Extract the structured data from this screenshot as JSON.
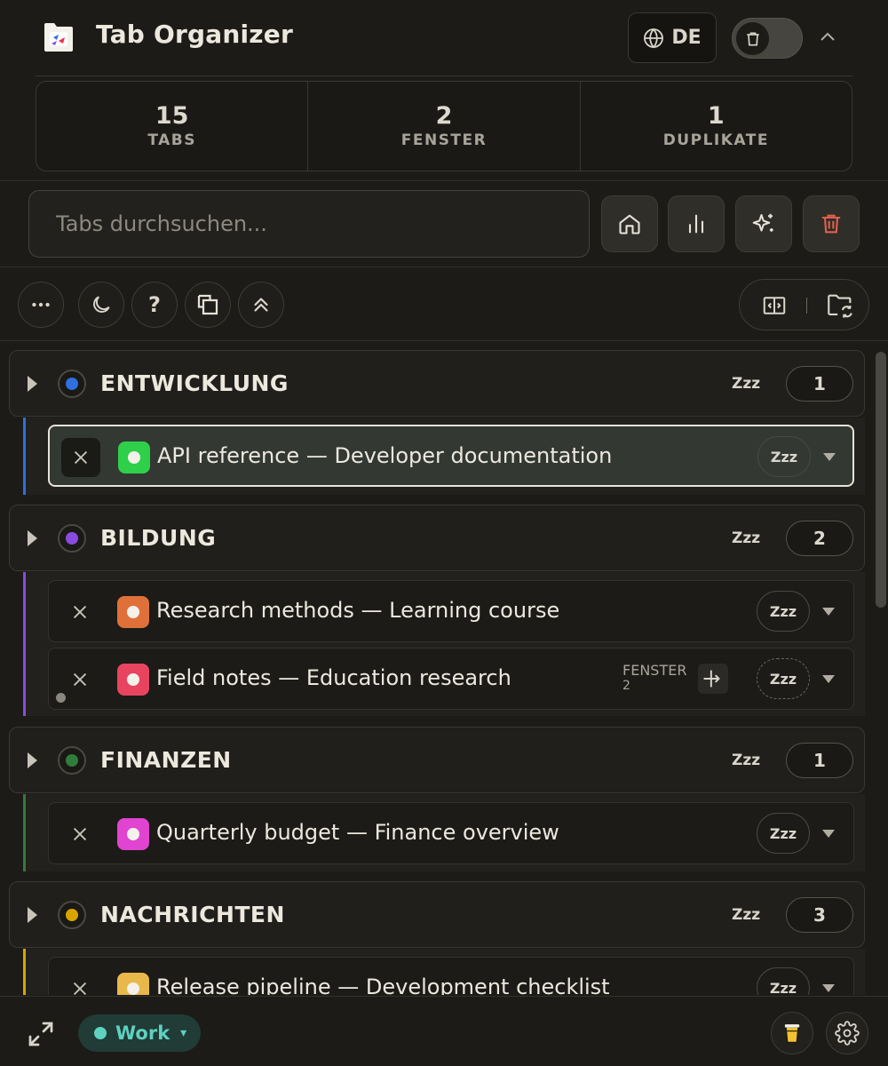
{
  "header": {
    "title": "Tab Organizer",
    "language": "DE"
  },
  "stats": [
    {
      "value": "15",
      "label": "TABS"
    },
    {
      "value": "2",
      "label": "FENSTER"
    },
    {
      "value": "1",
      "label": "DUPLIKATE"
    }
  ],
  "search": {
    "placeholder": "Tabs durchsuchen..."
  },
  "toolbar": {
    "help_label": "?"
  },
  "groups": [
    {
      "name": "ENTWICKLUNG",
      "count": "1",
      "zzz": "Zzz",
      "color": "#2f6fe0",
      "tabs": [
        {
          "title": "API reference — Developer documentation",
          "favicon_color": "#2ed04a",
          "zzz": "Zzz",
          "active": true
        }
      ]
    },
    {
      "name": "BILDUNG",
      "count": "2",
      "zzz": "Zzz",
      "color": "#8a4be0",
      "tabs": [
        {
          "title": "Research methods — Learning course",
          "favicon_color": "#e0703a",
          "zzz": "Zzz"
        },
        {
          "title": "Field notes — Education research",
          "favicon_color": "#e84460",
          "zzz": "Zzz",
          "window_label": "FENSTER",
          "window_number": "2"
        }
      ]
    },
    {
      "name": "FINANZEN",
      "count": "1",
      "zzz": "Zzz",
      "color": "#2e7d3a",
      "tabs": [
        {
          "title": "Quarterly budget — Finance overview",
          "favicon_color": "#e044d0",
          "zzz": "Zzz"
        }
      ]
    },
    {
      "name": "NACHRICHTEN",
      "count": "3",
      "zzz": "Zzz",
      "color": "#d9a400",
      "tabs": [
        {
          "title": "Release pipeline — Development checklist",
          "favicon_color": "#e8b84a",
          "zzz": "Zzz"
        }
      ]
    }
  ],
  "footer": {
    "profile_name": "Work",
    "profile_arrow": "▾"
  },
  "colors": {
    "background": "#1c1b18",
    "accent_teal": "#5fd1c0",
    "danger": "#e0604e"
  }
}
